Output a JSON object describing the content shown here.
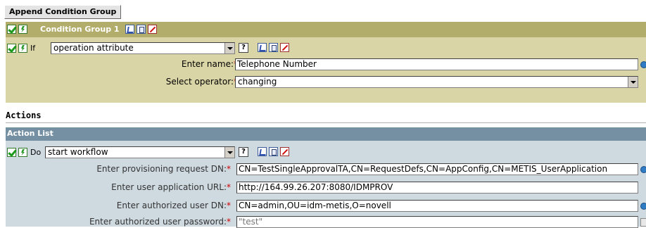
{
  "append_button_label": "Append Condition Group",
  "condition_group": {
    "title": "Condition Group 1",
    "if_label": "If",
    "condition_select": "operation attribute",
    "help_glyph": "?",
    "fields": [
      {
        "label": "Enter name:",
        "value": "Telephone Number"
      },
      {
        "label": "Select operator:",
        "value": "changing"
      }
    ],
    "required_marker": "*"
  },
  "actions": {
    "section_title": "Actions",
    "list_title": "Action List",
    "do_label": "Do",
    "action_select": "start workflow",
    "help_glyph": "?",
    "fields": [
      {
        "label": "Enter provisioning request DN:",
        "value": "CN=TestSingleApprovalTA,CN=RequestDefs,CN=AppConfig,CN=METIS_UserApplication"
      },
      {
        "label": "Enter user application URL:",
        "value": "http://164.99.26.207:8080/IDMPROV"
      },
      {
        "label": "Enter authorized user DN:",
        "value": "CN=admin,OU=idm-metis,O=novell"
      },
      {
        "label": "Enter authorized user password:",
        "value": "\"test\""
      }
    ]
  },
  "colors": {
    "condition_header": "#b3ad6b",
    "condition_body": "#dad5a6",
    "action_header": "#7690a3",
    "action_body": "#ced9e0",
    "required": "#d00000"
  },
  "icons": [
    "enable-check-icon",
    "enable-bolt-icon",
    "scissors-icon",
    "copy-icon",
    "delete-icon",
    "help-icon",
    "browse-icon",
    "edit-icon"
  ]
}
